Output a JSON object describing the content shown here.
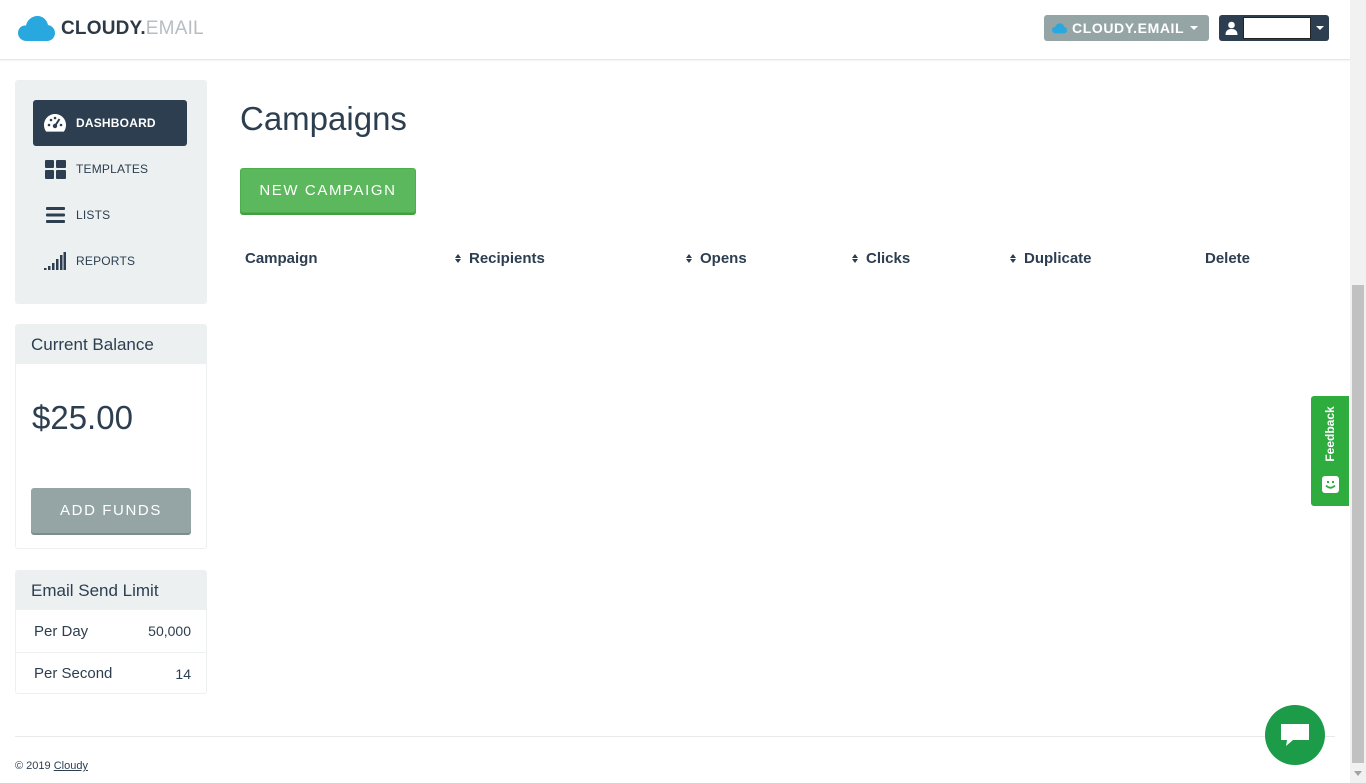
{
  "brand": {
    "name_main": "CLOUDY.",
    "name_suffix": "EMAIL",
    "icon": "cloud-icon",
    "accent": "#29a8e0"
  },
  "header": {
    "org_switcher_label": "CLOUDY.EMAIL",
    "user_menu_icon": "user-icon"
  },
  "sidebar": {
    "items": [
      {
        "label": "DASHBOARD",
        "icon": "dashboard-icon",
        "active": true
      },
      {
        "label": "TEMPLATES",
        "icon": "grid-icon",
        "active": false
      },
      {
        "label": "LISTS",
        "icon": "list-icon",
        "active": false
      },
      {
        "label": "REPORTS",
        "icon": "signal-bars-icon",
        "active": false
      }
    ]
  },
  "balance": {
    "title": "Current Balance",
    "amount": "$25.00",
    "add_funds_label": "ADD FUNDS"
  },
  "send_limit": {
    "title": "Email Send Limit",
    "rows": [
      {
        "label": "Per Day",
        "value": "50,000"
      },
      {
        "label": "Per Second",
        "value": "14"
      }
    ]
  },
  "main": {
    "title": "Campaigns",
    "new_campaign_label": "NEW CAMPAIGN",
    "table": {
      "columns": [
        {
          "label": "Campaign",
          "sortable": false
        },
        {
          "label": "Recipients",
          "sortable": true
        },
        {
          "label": "Opens",
          "sortable": true
        },
        {
          "label": "Clicks",
          "sortable": true
        },
        {
          "label": "Duplicate",
          "sortable": true
        },
        {
          "label": "Delete",
          "sortable": false
        }
      ],
      "rows": []
    }
  },
  "footer": {
    "copyright": "© 2019",
    "link_text": "Cloudy"
  },
  "feedback": {
    "label": "Feedback",
    "color": "#2eac3e"
  },
  "chat": {
    "icon": "chat-icon",
    "color": "#1c9b49"
  },
  "colors": {
    "primary": "#2c3e50",
    "success": "#5cb85c",
    "muted": "#95a5a6",
    "panel_bg": "#ecf0f1"
  }
}
